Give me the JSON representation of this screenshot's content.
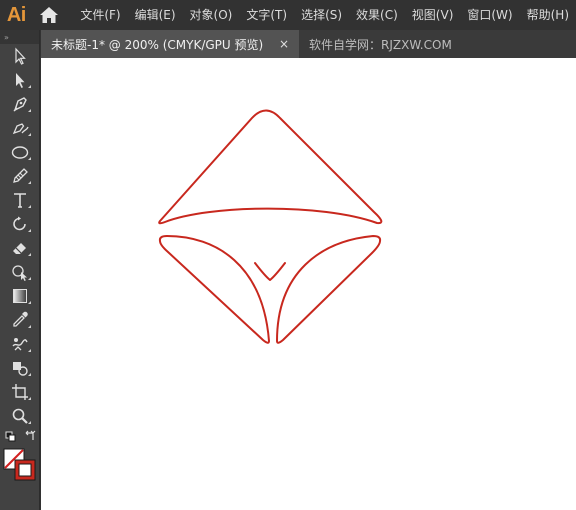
{
  "app": {
    "logo_text": "Ai",
    "accent": "#e4963a"
  },
  "menu": {
    "items": [
      "文件(F)",
      "编辑(E)",
      "对象(O)",
      "文字(T)",
      "选择(S)",
      "效果(C)",
      "视图(V)",
      "窗口(W)",
      "帮助(H)"
    ]
  },
  "tabs": {
    "active": {
      "label": "未标题-1* @ 200% (CMYK/GPU 预览)",
      "close": "×"
    },
    "inactive": {
      "label": "软件自学网：RJZXW.COM"
    }
  },
  "toolbar": {
    "grip": "»",
    "tools": [
      "selection-tool",
      "direct-selection-tool",
      "pen-tool",
      "curvature-tool",
      "ellipse-tool",
      "pencil-tool",
      "type-tool",
      "rotate-tool",
      "eraser-tool",
      "shape-builder-tool",
      "gradient-tool",
      "eyedropper-tool",
      "puppet-warp-tool",
      "symbol-tool",
      "artboard-tool",
      "zoom-tool"
    ]
  },
  "colors": {
    "stroke": "#c8281e",
    "canvas_bg": "#ffffff",
    "ui_bg": "#323232",
    "panel_bg": "#424242"
  }
}
